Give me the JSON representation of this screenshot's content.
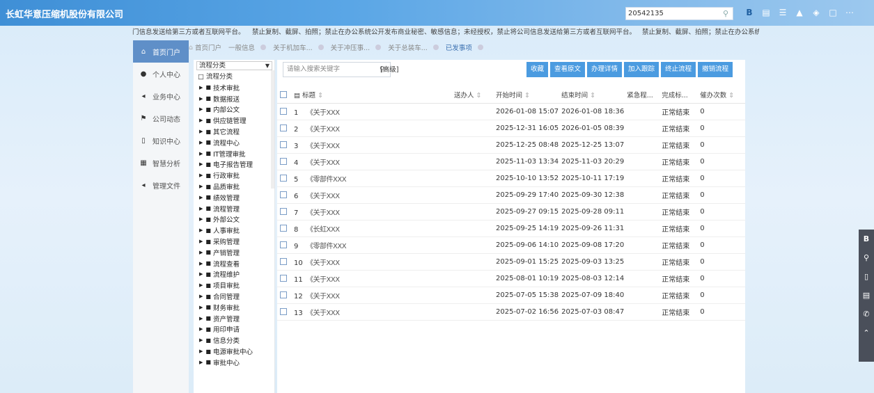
{
  "header": {
    "title": "长虹华意压缩机股份有限公司",
    "search_value": "20542135"
  },
  "notice": {
    "seg1": "门信息发送给第三方或者互联网平台。",
    "seg2": "禁止复制、截屏、拍照；禁止在办公系统公开发布商业秘密、敏感信息；未经授权，禁止将公司信息发送给第三方或者互联网平台。",
    "seg3": "禁止复制、截屏、拍照；禁止在办公系统"
  },
  "leftnav": [
    {
      "label": "首页门户",
      "icon": "home-icon",
      "active": true
    },
    {
      "label": "个人中心",
      "icon": "user-icon",
      "active": false
    },
    {
      "label": "业务中心",
      "icon": "share-icon",
      "active": false
    },
    {
      "label": "公司动态",
      "icon": "flag-icon",
      "active": false
    },
    {
      "label": "知识中心",
      "icon": "book-icon",
      "active": false
    },
    {
      "label": "智慧分析",
      "icon": "chart-icon",
      "active": false
    },
    {
      "label": "管理文件",
      "icon": "share-icon",
      "active": false
    }
  ],
  "tabs": [
    {
      "label": "首页门户"
    },
    {
      "label": "一般信息"
    },
    {
      "label": "关于机加车..."
    },
    {
      "label": "关于冲压事..."
    },
    {
      "label": "关于总装车..."
    },
    {
      "label": "已发事项"
    }
  ],
  "tree": {
    "select_value": "流程分类",
    "root": "流程分类",
    "items": [
      "技术审批",
      "数据报送",
      "内部公文",
      "供应链管理",
      "其它流程",
      "流程中心",
      "IT管理审批",
      "电子报告管理",
      "行政审批",
      "品质审批",
      "绩效管理",
      "流程管理",
      "外部公文",
      "人事审批",
      "采购管理",
      "产销管理",
      "流程查看",
      "流程维护",
      "项目审批",
      "合同管理",
      "财务审批",
      "资产管理",
      "用印申请",
      "信息分类",
      "电源审批中心",
      "审批中心"
    ]
  },
  "toolbar": {
    "keyword_placeholder": "请输入搜索关键字",
    "advanced": "[高级]",
    "buttons": [
      "收藏",
      "查看原文",
      "办理详情",
      "加入跟踪",
      "终止流程",
      "撤销流程"
    ]
  },
  "table": {
    "headers": [
      "标题",
      "送办人",
      "开始时间",
      "结束时间",
      "紧急程...",
      "完成标...",
      "催办次数"
    ],
    "rows": [
      {
        "no": "1",
        "title": "《关于XXX",
        "start": "2026-01-08 15:07",
        "end": "2026-01-08 18:36",
        "status": "正常结束",
        "count": "0"
      },
      {
        "no": "2",
        "title": "《关于XXX",
        "start": "2025-12-31 16:05",
        "end": "2026-01-05 08:39",
        "status": "正常结束",
        "count": "0"
      },
      {
        "no": "3",
        "title": "《关于XXX",
        "start": "2025-12-25 08:48",
        "end": "2025-12-25 13:07",
        "status": "正常结束",
        "count": "0"
      },
      {
        "no": "4",
        "title": "《关于XXX",
        "start": "2025-11-03 13:34",
        "end": "2025-11-03 20:29",
        "status": "正常结束",
        "count": "0"
      },
      {
        "no": "5",
        "title": "《零部件XXX",
        "start": "2025-10-10 13:52",
        "end": "2025-10-11 17:19",
        "status": "正常结束",
        "count": "0"
      },
      {
        "no": "6",
        "title": "《关于XXX",
        "start": "2025-09-29 17:40",
        "end": "2025-09-30 12:38",
        "status": "正常结束",
        "count": "0"
      },
      {
        "no": "7",
        "title": "《关于XXX",
        "start": "2025-09-27 09:15",
        "end": "2025-09-28 09:11",
        "status": "正常结束",
        "count": "0"
      },
      {
        "no": "8",
        "title": "《长虹XXX",
        "start": "2025-09-25 14:19",
        "end": "2025-09-26 11:31",
        "status": "正常结束",
        "count": "0"
      },
      {
        "no": "9",
        "title": "《零部件XXX",
        "start": "2025-09-06 14:10",
        "end": "2025-09-08 17:20",
        "status": "正常结束",
        "count": "0"
      },
      {
        "no": "10",
        "title": "《关于XXX",
        "start": "2025-09-01 15:25",
        "end": "2025-09-03 13:25",
        "status": "正常结束",
        "count": "0"
      },
      {
        "no": "11",
        "title": "《关于XXX",
        "start": "2025-08-01 10:19",
        "end": "2025-08-03 12:14",
        "status": "正常结束",
        "count": "0"
      },
      {
        "no": "12",
        "title": "《关于XXX",
        "start": "2025-07-05 15:38",
        "end": "2025-07-09 18:40",
        "status": "正常结束",
        "count": "0"
      },
      {
        "no": "13",
        "title": "《关于XXX",
        "start": "2025-07-02 16:56",
        "end": "2025-07-03 08:47",
        "status": "正常结束",
        "count": "0"
      }
    ]
  },
  "colors": {
    "topbar": "#3f8fd6",
    "active_nav": "#5f8fc8",
    "button": "#4b9be0"
  }
}
